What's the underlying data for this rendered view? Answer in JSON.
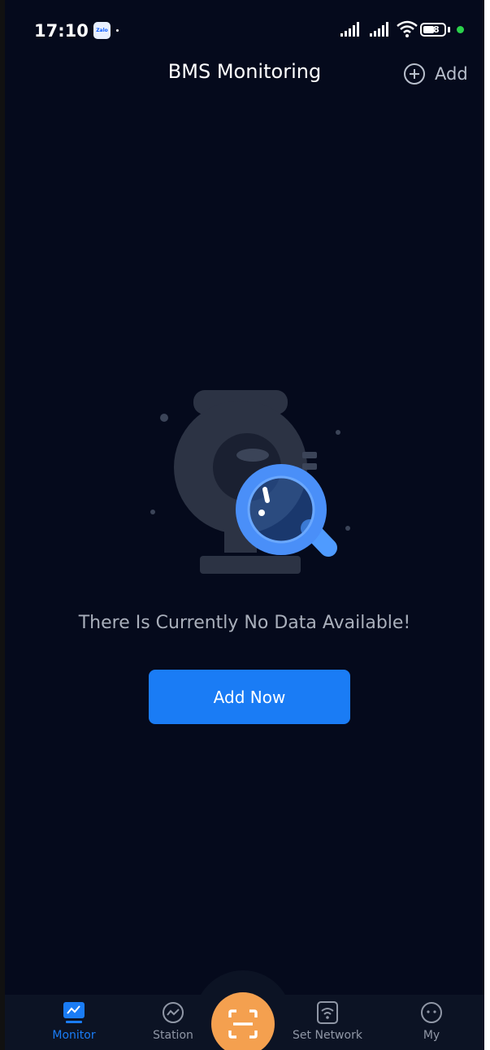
{
  "status_bar": {
    "time": "17:10",
    "zalo_label": "Zalo",
    "battery": "48"
  },
  "header": {
    "title": "BMS Monitoring",
    "add_label": "Add"
  },
  "empty_state": {
    "message": "There Is Currently No Data Available!",
    "button_label": "Add Now"
  },
  "tabs": [
    {
      "label": "Monitor",
      "icon": "monitor-icon",
      "active": true
    },
    {
      "label": "Station",
      "icon": "chart-circle-icon",
      "active": false
    },
    {
      "label": "Set Network",
      "icon": "wifi-icon",
      "active": false
    },
    {
      "label": "My",
      "icon": "face-icon",
      "active": false
    }
  ],
  "colors": {
    "background": "#050a1c",
    "accent": "#1a7cf5",
    "scan_button": "#f4a04f"
  }
}
